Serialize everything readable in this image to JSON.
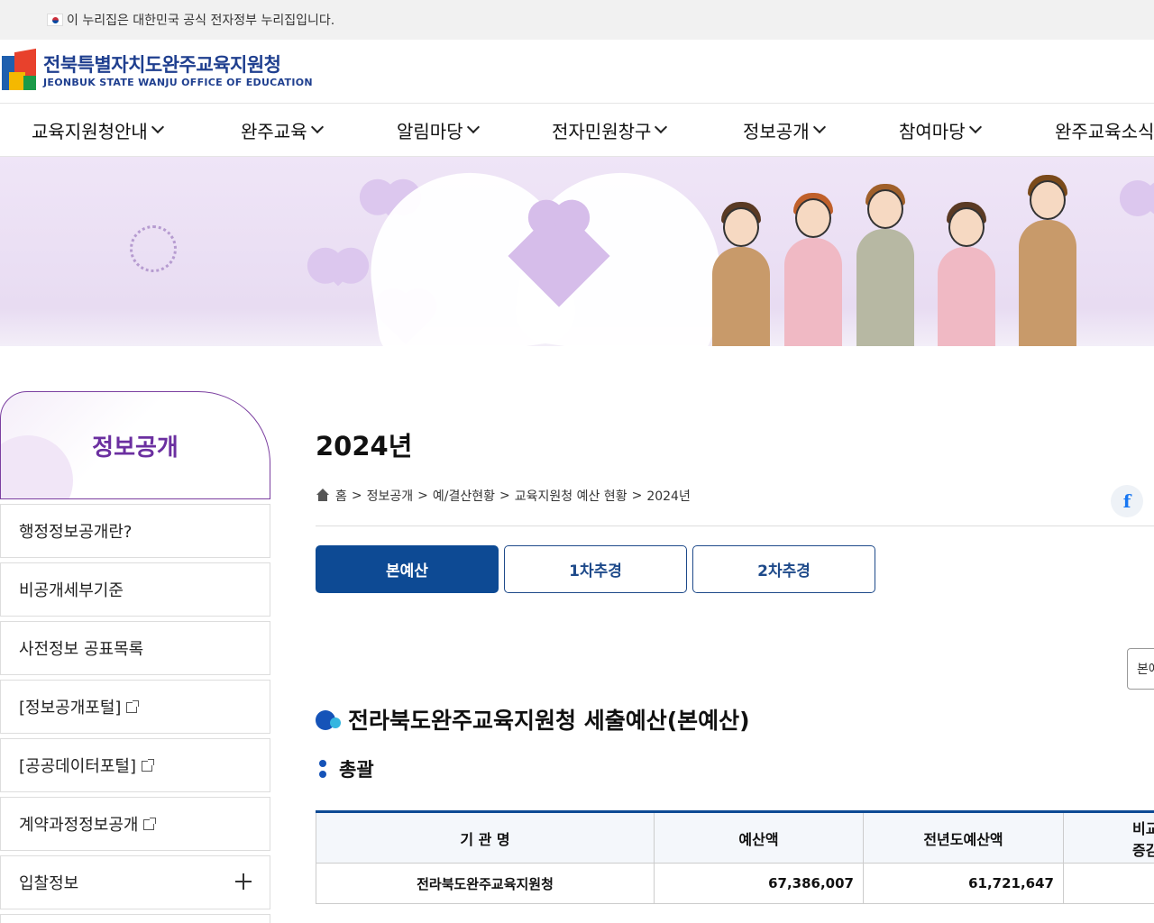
{
  "gov_bar": {
    "text": "이 누리집은 대한민국 공식 전자정부 누리집입니다."
  },
  "logo": {
    "korean": "전북특별자치도완주교육지원청",
    "english": "JEONBUK STATE WANJU OFFICE OF EDUCATION"
  },
  "gnb": {
    "items": [
      {
        "label": "교육지원청안내"
      },
      {
        "label": "완주교육"
      },
      {
        "label": "알림마당"
      },
      {
        "label": "전자민원창구"
      },
      {
        "label": "정보공개"
      },
      {
        "label": "참여마당"
      },
      {
        "label": "완주교육소식"
      }
    ]
  },
  "lnb": {
    "title": "정보공개",
    "items": [
      {
        "label": "행정정보공개란?"
      },
      {
        "label": "비공개세부기준"
      },
      {
        "label": "사전정보 공표목록"
      },
      {
        "label": "[정보공개포털]"
      },
      {
        "label": "[공공데이터포털]"
      },
      {
        "label": "계약과정정보공개"
      },
      {
        "label": "입찰정보"
      }
    ]
  },
  "page": {
    "title": "2024년",
    "breadcrumb": [
      "홈",
      "정보공개",
      "예/결산현황",
      "교육지원청 예산 현황",
      "2024년"
    ],
    "breadcrumb_sep": ">",
    "facebook_glyph": "f"
  },
  "tabs": [
    {
      "label": "본예산",
      "active": true
    },
    {
      "label": "1차추경",
      "active": false
    },
    {
      "label": "2차추경",
      "active": false
    }
  ],
  "select": {
    "value": "본예산"
  },
  "section": {
    "title": "전라북도완주교육지원청 세출예산(본예산)",
    "subtitle": "총괄"
  },
  "table": {
    "headers": [
      "기 관 명",
      "예산액",
      "전년도예산액",
      "비교증감"
    ],
    "rows": [
      {
        "org": "전라북도완주교육지원청",
        "budget": "67,386,007",
        "prev_budget": "61,721,647"
      }
    ]
  },
  "colors": {
    "primary": "#0d4a94",
    "accent_purple": "#6b2fa0",
    "gov_bar_bg": "#f1f1f1"
  }
}
